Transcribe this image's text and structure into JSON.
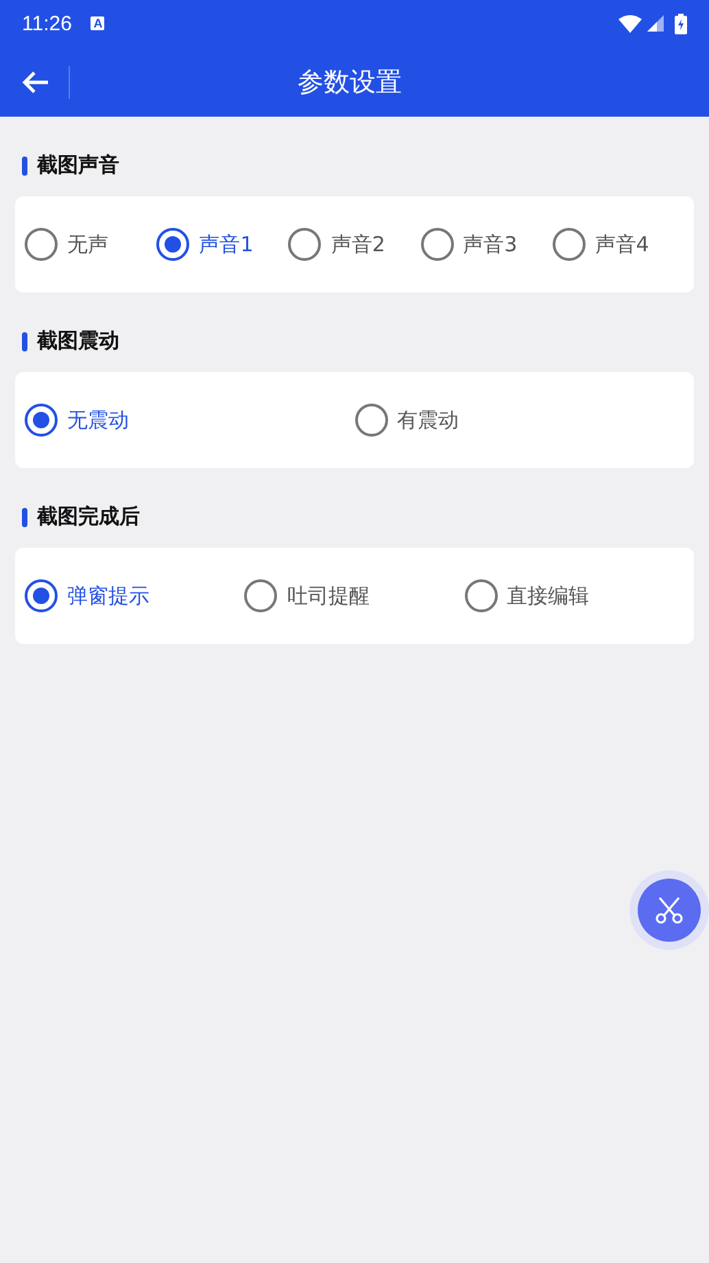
{
  "status_bar": {
    "time": "11:26",
    "notification": "A"
  },
  "header": {
    "title": "参数设置"
  },
  "sections": [
    {
      "title": "截图声音",
      "options": [
        {
          "label": "无声",
          "selected": false
        },
        {
          "label": "声音1",
          "selected": true
        },
        {
          "label": "声音2",
          "selected": false
        },
        {
          "label": "声音3",
          "selected": false
        },
        {
          "label": "声音4",
          "selected": false
        }
      ]
    },
    {
      "title": "截图震动",
      "options": [
        {
          "label": "无震动",
          "selected": true
        },
        {
          "label": "有震动",
          "selected": false
        }
      ]
    },
    {
      "title": "截图完成后",
      "options": [
        {
          "label": "弹窗提示",
          "selected": true
        },
        {
          "label": "吐司提醒",
          "selected": false
        },
        {
          "label": "直接编辑",
          "selected": false
        }
      ]
    }
  ]
}
